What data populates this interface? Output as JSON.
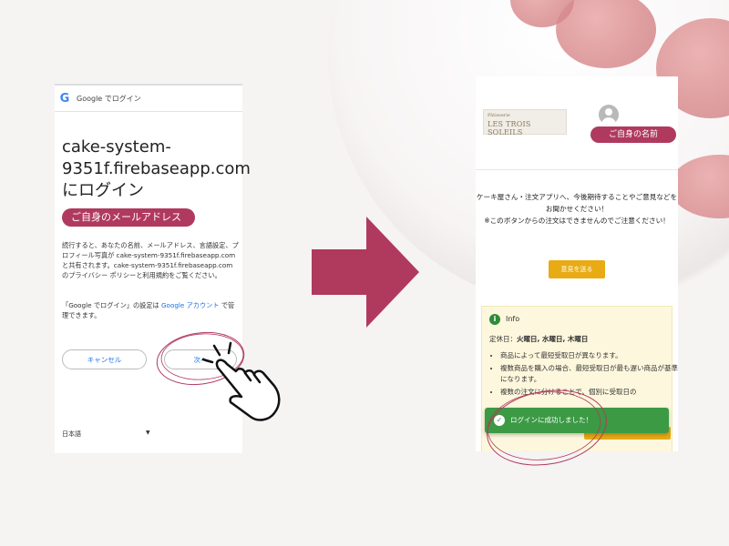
{
  "google_login": {
    "header_logo": "G",
    "header_text": "Google でログイン",
    "title": "cake-system-9351f.firebaseapp.com にログイン",
    "email_pill": "ご自身のメールアドレス",
    "description": "続行すると、あなたの名前、メールアドレス、言語設定、プロフィール写真が cake-system-9351f.firebaseapp.com と共有されます。cake-system-9351f.firebaseapp.com のプライバシー ポリシーと利用規約をご覧ください。",
    "note_prefix": "「Google でログイン」の設定は ",
    "note_link": "Google アカウント",
    "note_suffix": " で管理できます。",
    "cancel_label": "キャンセル",
    "next_label": "次へ",
    "language": "日本語",
    "language_arrow": "▼"
  },
  "cake_app": {
    "logo_small": "Pâtisserie",
    "logo_name": "LES TROIS SOLEILS",
    "user_name_pill": "ご自身の名前",
    "message_line1": "ケーキ屋さん・注文アプリへ、今後期待することやご意見などを",
    "message_line2": "お聞かせください！",
    "message_line3": "※このボタンからの注文はできませんのでご注意ください！",
    "feedback_button": "意見を送る",
    "info_icon": "i",
    "info_title": "Info",
    "holiday_label": "定休日：",
    "holiday_days": "火曜日, 水曜日, 木曜日",
    "info_items": [
      "商品によって最短受取日が異なります。",
      "複数商品を購入の場合、最短受取日が最も遅い商品が基準になります。",
      "複数の注文に分けることで、個別に受取日の"
    ],
    "toast_icon": "✓",
    "toast_text": "ログインに成功しました！"
  },
  "colors": {
    "accent": "#b03a5e",
    "google_blue": "#1a73e8",
    "feedback_yellow": "#e8ab14",
    "success_green": "#3c9a45",
    "info_bg": "#fdf7dd"
  },
  "icons": [
    "google-logo-icon",
    "arrow-right-icon",
    "pointing-hand-icon",
    "user-avatar-icon",
    "info-icon",
    "check-icon"
  ]
}
